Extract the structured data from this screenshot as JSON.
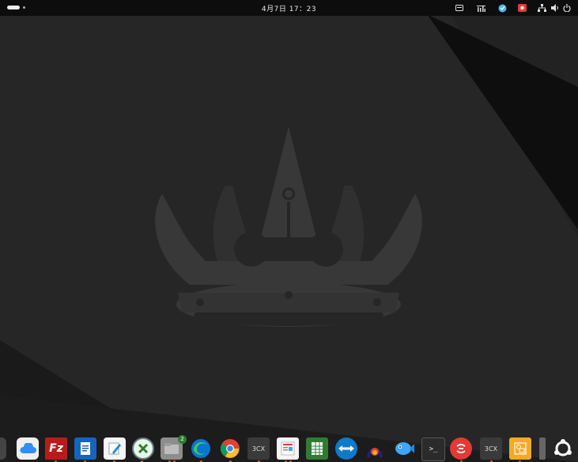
{
  "topbar": {
    "clock": "4月7日 17：23",
    "workspace_indicator": "activities"
  },
  "tray_icons": [
    "keyboard-icon",
    "bars-chart-icon",
    "updater-icon",
    "screen-record-icon",
    "network-icon",
    "volume-icon",
    "power-icon"
  ],
  "dock": {
    "items": [
      {
        "name": "partial-app-left",
        "icon": "app-icon"
      },
      {
        "name": "icloud",
        "icon": "cloud-icon"
      },
      {
        "name": "filezilla",
        "icon": "filezilla-icon",
        "label": "Fz"
      },
      {
        "name": "document-viewer",
        "icon": "document-icon"
      },
      {
        "name": "text-editor",
        "icon": "pencil-icon"
      },
      {
        "name": "crossover",
        "icon": "crossover-icon"
      },
      {
        "name": "files",
        "icon": "folder-icon",
        "badge": "2"
      },
      {
        "name": "edge",
        "icon": "edge-icon"
      },
      {
        "name": "chrome",
        "icon": "chrome-icon"
      },
      {
        "name": "3cx-1",
        "icon": "3cx-icon",
        "label": "3CX"
      },
      {
        "name": "reader",
        "icon": "reader-icon"
      },
      {
        "name": "spreadsheet",
        "icon": "spreadsheet-icon"
      },
      {
        "name": "teamviewer",
        "icon": "teamviewer-icon"
      },
      {
        "name": "anydesk-like",
        "icon": "arch-icon"
      },
      {
        "name": "fish-app",
        "icon": "fish-icon"
      },
      {
        "name": "terminal",
        "icon": "terminal-icon",
        "label": ">_"
      },
      {
        "name": "red-app",
        "icon": "red-circle-icon"
      },
      {
        "name": "3cx-2",
        "icon": "3cx-icon",
        "label": "3CX"
      },
      {
        "name": "tweaks",
        "icon": "gallery-icon"
      },
      {
        "name": "trash-partial",
        "icon": "trash-icon"
      },
      {
        "name": "show-apps",
        "icon": "ubuntu-icon"
      }
    ]
  },
  "colors": {
    "background": "#1e1e1e",
    "topbar": "#0d0d0d",
    "crown": "#3a3a3a",
    "running_dot": "#e05a2a"
  }
}
